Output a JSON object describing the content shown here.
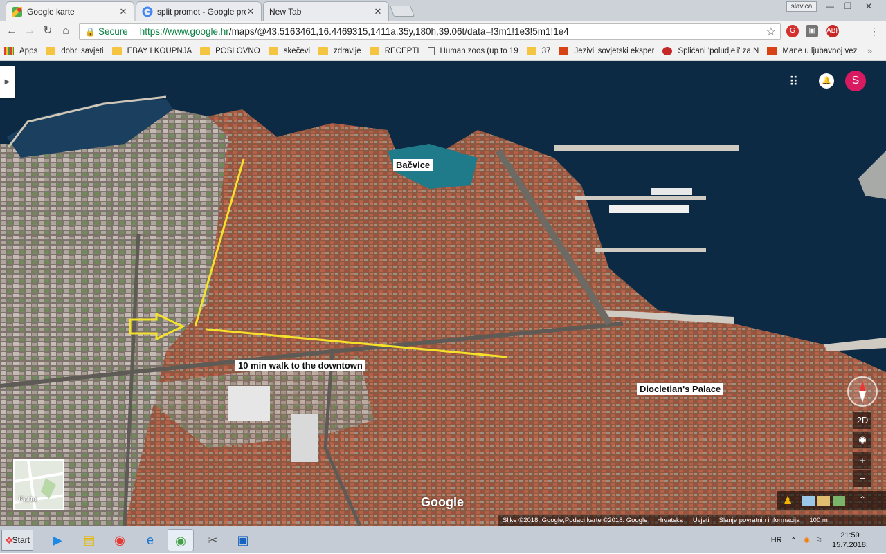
{
  "browser": {
    "tabs": [
      {
        "title": "Google karte",
        "active": true
      },
      {
        "title": "split promet - Google pretra",
        "active": false
      },
      {
        "title": "New Tab",
        "active": false
      }
    ],
    "profile": "slavica",
    "secure_label": "Secure",
    "url_host": "https://www.google.hr",
    "url_rest": "/maps/@43.5163461,16.4469315,1411a,35y,180h,39.06t/data=!3m1!1e3!5m1!1e4"
  },
  "bookmarks": [
    {
      "label": "Apps",
      "icon": "apps-grid-icon"
    },
    {
      "label": "dobri savjeti",
      "icon": "folder-icon"
    },
    {
      "label": "EBAY I KOUPNJA",
      "icon": "folder-icon"
    },
    {
      "label": "POSLOVNO",
      "icon": "folder-icon"
    },
    {
      "label": "skečevi",
      "icon": "folder-icon"
    },
    {
      "label": "zdravlje",
      "icon": "folder-icon"
    },
    {
      "label": "RECEPTI",
      "icon": "folder-icon"
    },
    {
      "label": "Human zoos (up to 19",
      "icon": "page-icon"
    },
    {
      "label": "37",
      "icon": "folder-icon"
    },
    {
      "label": "Jezivi 'sovjetski eksper",
      "icon": "news-icon"
    },
    {
      "label": "Splićani 'poludjeli' za N",
      "icon": "sd-icon"
    },
    {
      "label": "Mane u ljubavnoj vez",
      "icon": "news-icon"
    }
  ],
  "map": {
    "labels": {
      "bacvice": "Bačvice",
      "walk": "10 min walk to the downtown",
      "palace": "Diocletian's Palace"
    },
    "avatar_letter": "S",
    "minimap_label": "Karta",
    "view_2d": "2D",
    "zoom_in": "+",
    "zoom_out": "−",
    "logo": "Google",
    "footer": {
      "imagery": "Slike ©2018. Google,Podaci karte ©2018. Google",
      "country": "Hrvatska",
      "terms": "Uvjeti",
      "feedback": "Slanje povratnih informacija",
      "scale": "100 m"
    },
    "route_color": "#f5e12a"
  },
  "taskbar": {
    "start": "Start",
    "lang": "HR",
    "time": "21:59",
    "date": "15.7.2018."
  }
}
